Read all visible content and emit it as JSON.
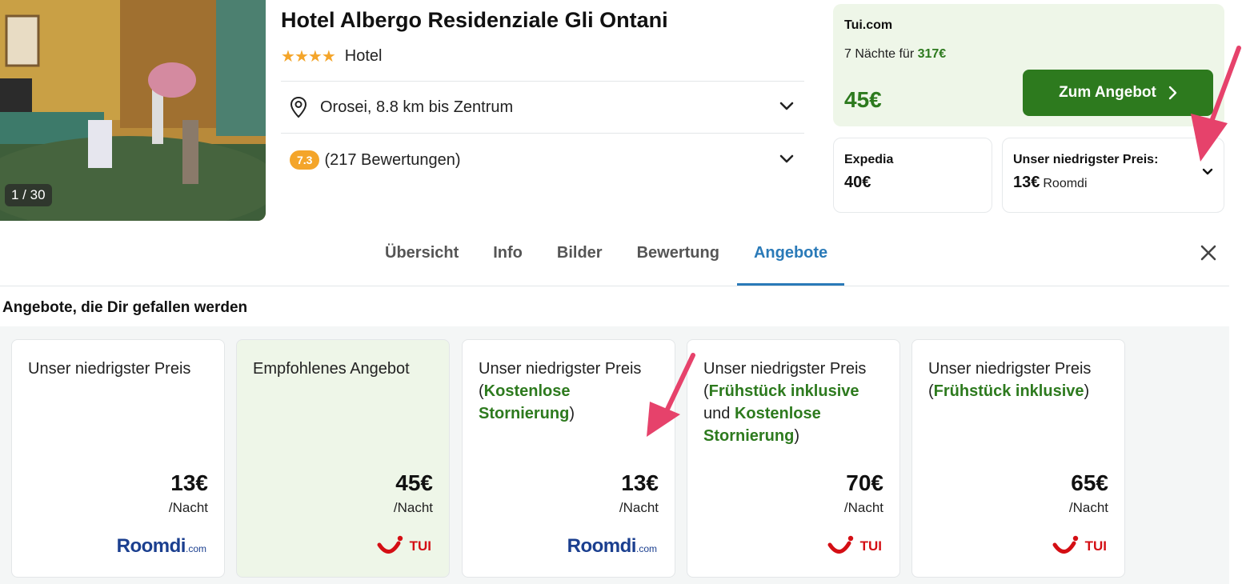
{
  "gallery": {
    "counter": "1 / 30"
  },
  "hotel": {
    "name": "Hotel Albergo Residenziale Gli Ontani",
    "star_count": 4,
    "type": "Hotel",
    "location": "Orosei, 8.8 km bis Zentrum",
    "rating": "7.3",
    "reviews": "(217 Bewertungen)"
  },
  "top_deal": {
    "provider": "Tui.com",
    "nights_text": "7 Nächte für",
    "nights_price": "317€",
    "price": "45€",
    "button_label": "Zum Angebot"
  },
  "alt_deal": {
    "provider": "Expedia",
    "price": "40€"
  },
  "lowest_price": {
    "label": "Unser niedrigster Preis:",
    "price": "13€",
    "source": "Roomdi"
  },
  "tabs": [
    {
      "label": "Übersicht",
      "active": false
    },
    {
      "label": "Info",
      "active": false
    },
    {
      "label": "Bilder",
      "active": false
    },
    {
      "label": "Bewertung",
      "active": false
    },
    {
      "label": "Angebote",
      "active": true
    }
  ],
  "section_heading": "Angebote, die Dir gefallen werden",
  "offers": [
    {
      "heading": "Unser niedrigster Preis",
      "price": "13€",
      "unit": "/Nacht",
      "logo": "Roomdi"
    },
    {
      "heading": "Empfohlenes Angebot",
      "price": "45€",
      "unit": "/Nacht",
      "logo": "TUI"
    },
    {
      "heading_a": "Unser niedrigster Preis",
      "paren_open": "(",
      "highlight": "Kostenlose Stornierung",
      "paren_close": ")",
      "price": "13€",
      "unit": "/Nacht",
      "logo": "Roomdi"
    },
    {
      "heading_a": "Unser niedrigster Preis",
      "paren_open": "(",
      "highlight1": "Frühstück inklusive",
      "joiner": "und",
      "highlight2": "Kostenlose Stornierung",
      "paren_close": ")",
      "price": "70€",
      "unit": "/Nacht",
      "logo": "TUI"
    },
    {
      "heading_a": "Unser niedrigster Preis",
      "paren_open": "(",
      "highlight": "Frühstück inklusive",
      "paren_close": ")",
      "price": "65€",
      "unit": "/Nacht",
      "logo": "TUI"
    }
  ],
  "logos": {
    "roomdi_main": "Roomdi",
    "roomdi_suffix": ".com",
    "tui": "TUI"
  },
  "colors": {
    "accent_green": "#2d7a1e",
    "tab_blue": "#2a7ab8",
    "star": "#f4a52a",
    "annotation_arrow": "#e6426b",
    "roomdi_blue": "#1b3f8f",
    "tui_red": "#d40e14"
  },
  "icons": [
    "location-pin-icon",
    "chevron-down-icon",
    "chevron-right-icon",
    "close-icon",
    "star-icon"
  ]
}
